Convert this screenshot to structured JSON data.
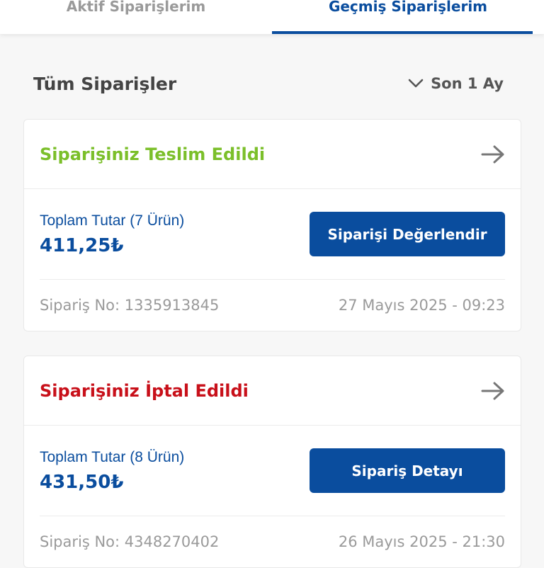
{
  "tabs": {
    "active_orders": "Aktif Siparişlerim",
    "past_orders": "Geçmiş Siparişlerim"
  },
  "filter": {
    "title": "Tüm Siparişler",
    "period": "Son 1 Ay"
  },
  "orders": [
    {
      "status": "Siparişiniz Teslim Edildi",
      "status_color": "#7bbf2a",
      "total_label": "Toplam Tutar (7 Ürün)",
      "total_value": "411,25₺",
      "action": "Siparişi Değerlendir",
      "order_no": "Sipariş No: 1335913845",
      "date": "27 Mayıs 2025 - 09:23"
    },
    {
      "status": "Siparişiniz İptal Edildi",
      "status_color": "#c8101a",
      "total_label": "Toplam Tutar (8 Ürün)",
      "total_value": "431,50₺",
      "action": "Sipariş Detayı",
      "order_no": "Sipariş No: 4348270402",
      "date": "26 Mayıs 2025 - 21:30"
    }
  ],
  "colors": {
    "primary": "#0a4d9e",
    "muted": "#9a9a9a"
  }
}
